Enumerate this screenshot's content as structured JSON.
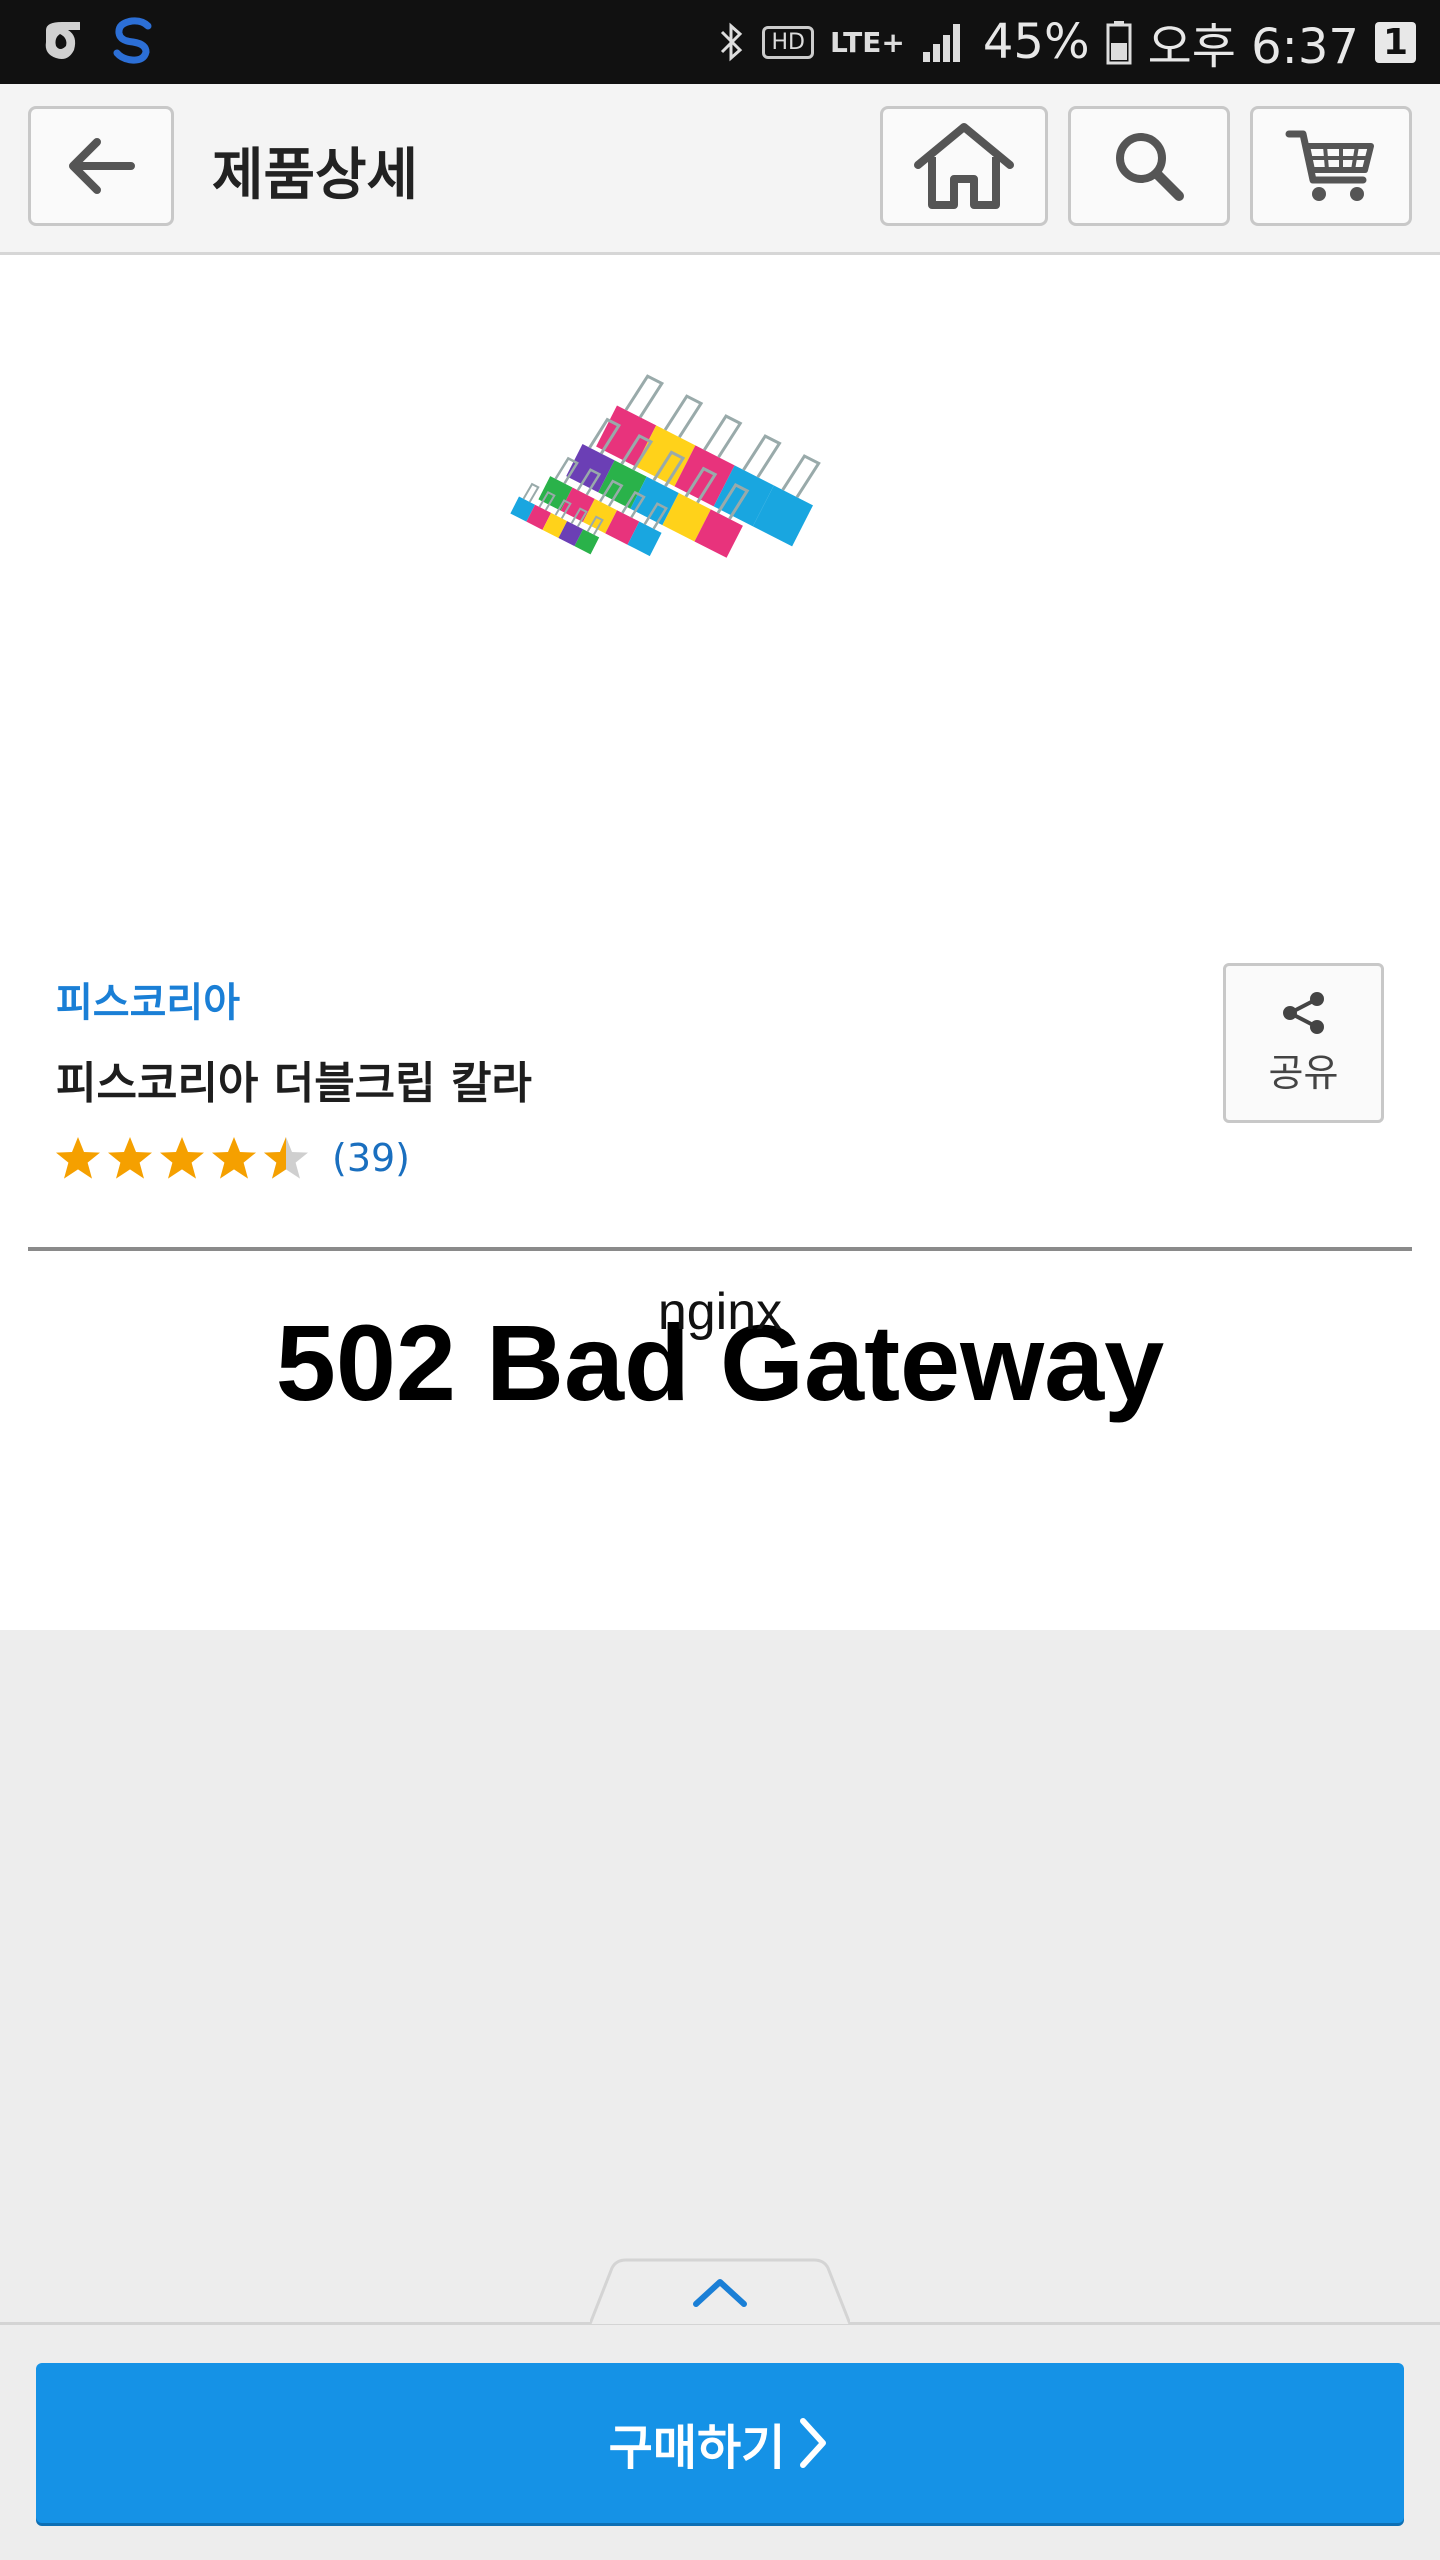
{
  "status_bar": {
    "battery": "45%",
    "time": "오후 6:37",
    "network": "LTE+",
    "hd_label": "HD",
    "notification_badge": "1"
  },
  "toolbar": {
    "title": "제품상세"
  },
  "product": {
    "brand": "피스코리아",
    "name": "피스코리아 더블크립 칼라",
    "rating": 4.5,
    "review_count": "(39)",
    "share_label": "공유",
    "image_icon": "binder-clips-image"
  },
  "error": {
    "title": "502 Bad Gateway",
    "server": "nginx"
  },
  "footer": {
    "buy_label": "구매하기"
  },
  "colors": {
    "accent": "#1592e6",
    "link": "#1a7fd6",
    "star": "#f5a000"
  }
}
